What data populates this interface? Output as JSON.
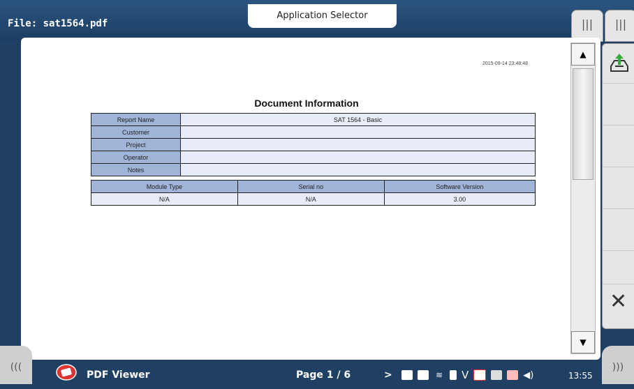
{
  "window": {
    "file_title": "File: sat1564.pdf",
    "app_selector": "Application Selector"
  },
  "handles": {
    "left_tab": "|||",
    "right_tab": "|||"
  },
  "document": {
    "timestamp": "2015-09-14 23:48:48",
    "title": "Document Information",
    "info_rows": [
      {
        "label": "Report Name",
        "value": "SAT 1564 - Basic"
      },
      {
        "label": "Customer",
        "value": ""
      },
      {
        "label": "Project",
        "value": ""
      },
      {
        "label": "Operator",
        "value": ""
      },
      {
        "label": "Notes",
        "value": ""
      }
    ],
    "module_headers": [
      "Module Type",
      "Serial no",
      "Software Version"
    ],
    "module_values": [
      "N/A",
      "N/A",
      "3.00"
    ]
  },
  "side_panel": {
    "close_label": "✕"
  },
  "bottom": {
    "nav_left": "(((",
    "nav_right": ")))",
    "app_name": "PDF Viewer",
    "page": "Page 1 / 6",
    "next": ">",
    "status_v": "V",
    "time": "13:55"
  },
  "colors": {
    "header_cell": "#9fb4d6",
    "value_cell": "#e8ecf8",
    "bar": "#1f3f63"
  }
}
